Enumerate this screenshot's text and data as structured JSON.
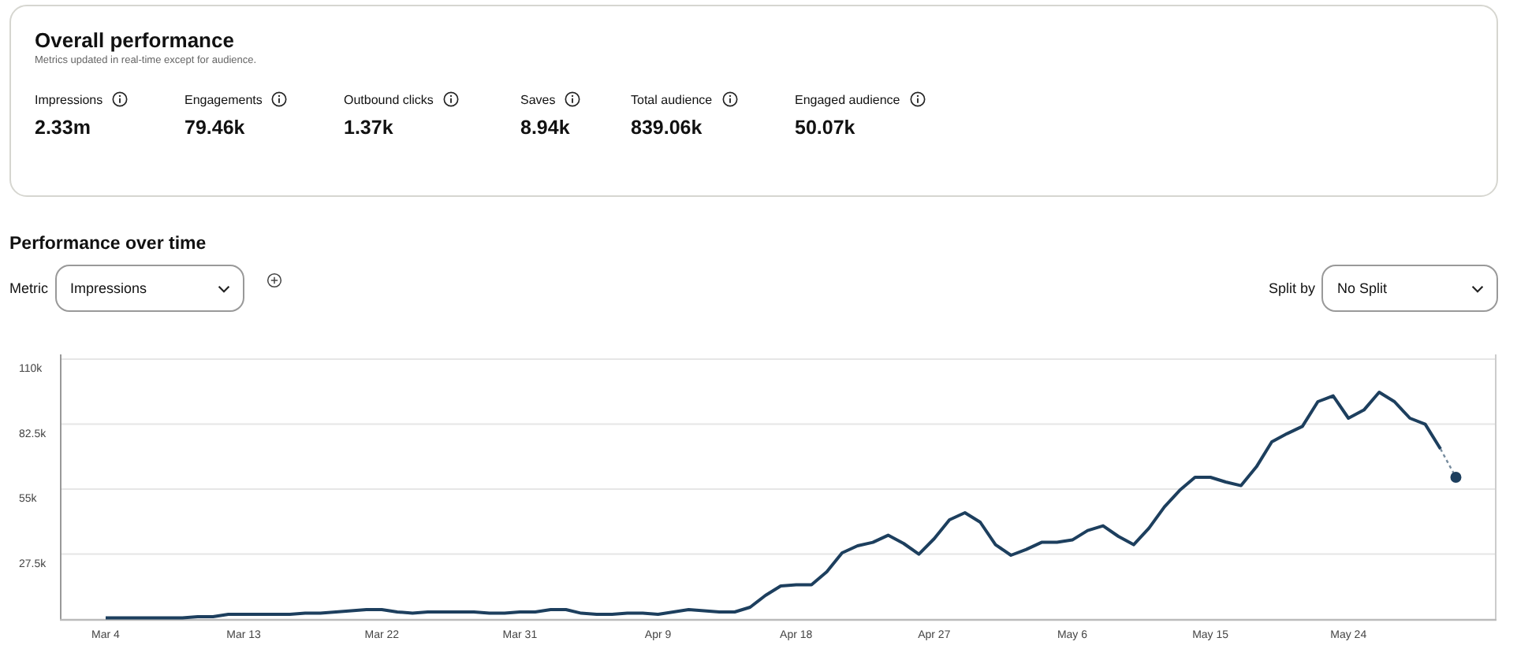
{
  "overview": {
    "title": "Overall performance",
    "subtitle": "Metrics updated in real-time except for audience.",
    "metrics": [
      {
        "label": "Impressions",
        "value": "2.33m"
      },
      {
        "label": "Engagements",
        "value": "79.46k"
      },
      {
        "label": "Outbound clicks",
        "value": "1.37k"
      },
      {
        "label": "Saves",
        "value": "8.94k"
      },
      {
        "label": "Total audience",
        "value": "839.06k"
      },
      {
        "label": "Engaged audience",
        "value": "50.07k"
      }
    ]
  },
  "performance": {
    "title": "Performance over time",
    "metric_select": {
      "label": "Metric",
      "value": "Impressions"
    },
    "split_select": {
      "label": "Split by",
      "value": "No Split"
    },
    "chart_data": {
      "type": "line",
      "ylim": [
        0,
        110
      ],
      "grid": true,
      "categories": [
        "Mar 4",
        null,
        null,
        null,
        null,
        null,
        null,
        null,
        null,
        "Mar 13",
        null,
        null,
        null,
        null,
        null,
        null,
        null,
        null,
        "Mar 22",
        null,
        null,
        null,
        null,
        null,
        null,
        null,
        null,
        "Mar 31",
        null,
        null,
        null,
        null,
        null,
        null,
        null,
        null,
        "Apr 9",
        null,
        null,
        null,
        null,
        null,
        null,
        null,
        null,
        "Apr 18",
        null,
        null,
        null,
        null,
        null,
        null,
        null,
        null,
        "Apr 27",
        null,
        null,
        null,
        null,
        null,
        null,
        null,
        null,
        "May 6",
        null,
        null,
        null,
        null,
        null,
        null,
        null,
        null,
        "May 15",
        null,
        null,
        null,
        null,
        null,
        null,
        null,
        null,
        "May 24",
        null,
        null,
        null,
        null,
        null,
        null,
        null
      ],
      "yticks": [
        {
          "value": 27.5,
          "label": "27.5k"
        },
        {
          "value": 55,
          "label": "55k"
        },
        {
          "value": 82.5,
          "label": "82.5k"
        },
        {
          "value": 110,
          "label": "110k"
        }
      ],
      "series": [
        {
          "color": "#1d3f5e",
          "values": [
            0.5,
            0.5,
            0.5,
            0.5,
            0.5,
            0.5,
            1,
            1,
            2,
            2,
            2,
            2,
            2,
            2.5,
            2.5,
            3,
            3.5,
            4,
            4,
            3,
            2.5,
            3,
            3,
            3,
            3,
            2.5,
            2.5,
            3,
            3,
            4,
            4,
            2.5,
            2,
            2,
            2.5,
            2.5,
            2,
            3,
            4,
            3.5,
            3,
            3,
            5,
            10,
            14,
            14.5,
            14.5,
            20,
            28,
            31,
            32.5,
            35.5,
            32,
            27.5,
            34,
            42,
            45,
            41,
            31.5,
            27,
            29.5,
            32.5,
            32.5,
            33.5,
            37.5,
            39.5,
            35,
            31.5,
            38.5,
            47.5,
            54.5,
            60,
            60,
            58,
            56.5,
            64.5,
            75,
            78.5,
            81.5,
            92,
            94.5,
            85,
            88.5,
            96,
            92,
            85,
            82.5,
            72,
            60
          ]
        }
      ]
    }
  }
}
